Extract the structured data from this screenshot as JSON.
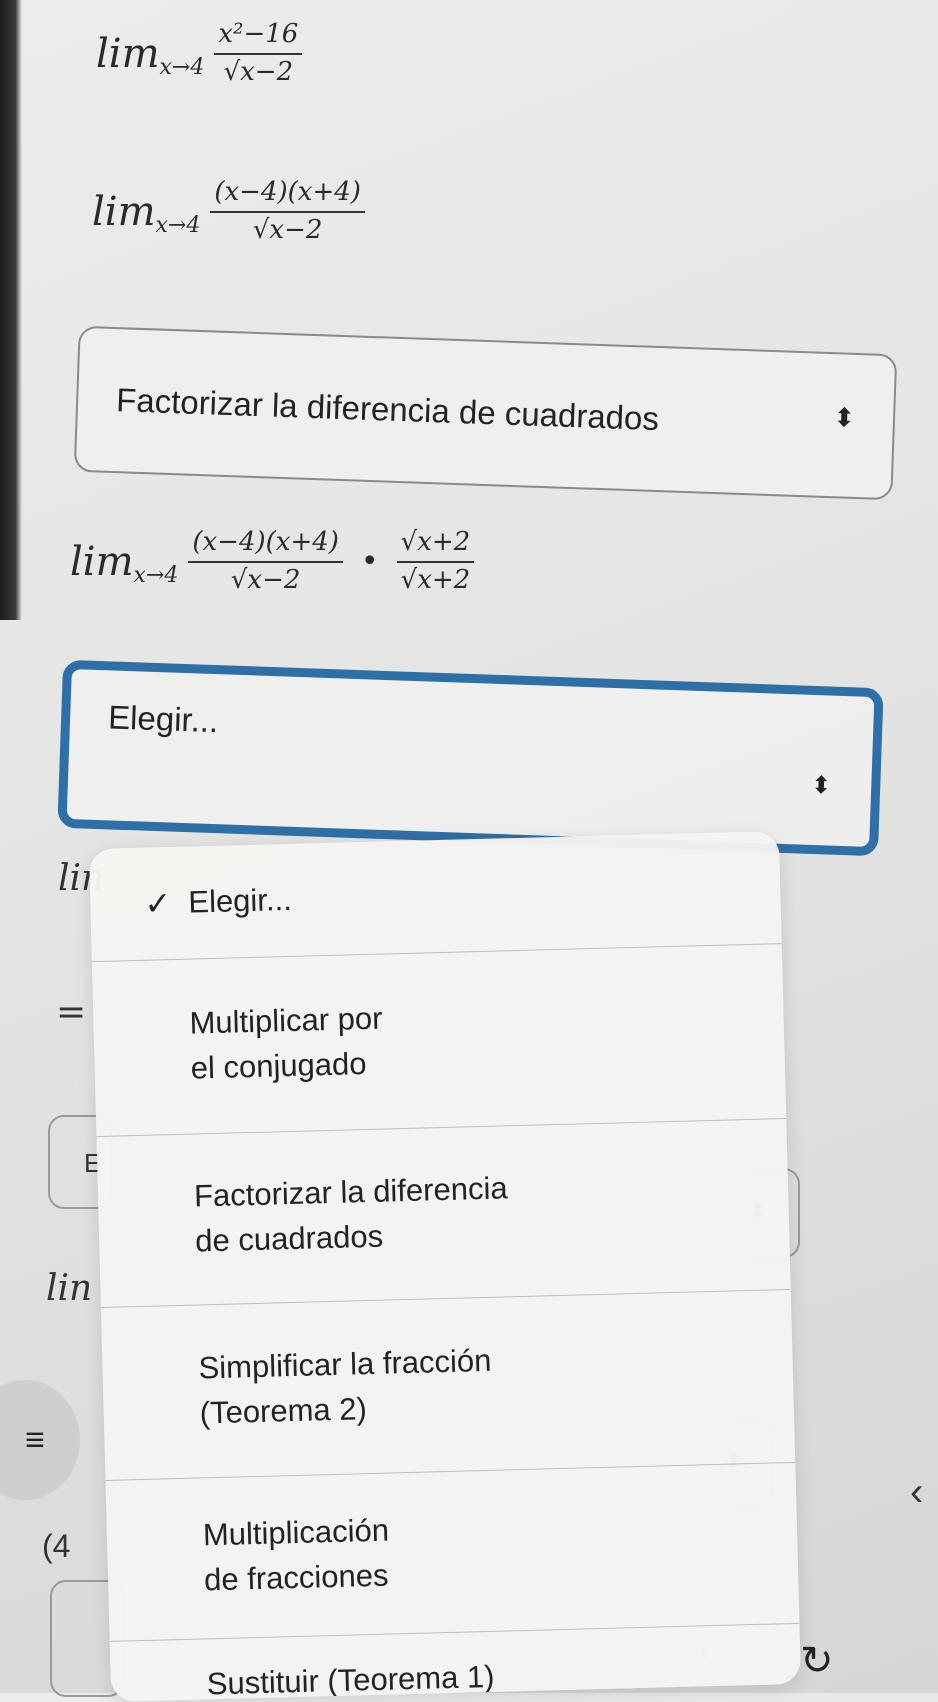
{
  "steps": {
    "step1": {
      "lim": "lim",
      "sub": "x→4",
      "num": "x²−16",
      "den": "√x−2"
    },
    "step2": {
      "lim": "lim",
      "sub": "x→4",
      "num": "(x−4)(x+4)",
      "den": "√x−2"
    },
    "select1": {
      "value": "Factorizar la diferencia de cuadrados",
      "arrow": "⬍"
    },
    "step3": {
      "lim": "lim",
      "sub": "x→4",
      "num": "(x−4)(x+4)",
      "den": "√x−2",
      "dot": "•",
      "num2": "√x+2",
      "den2": "√x+2"
    },
    "select2": {
      "value": "Elegir...",
      "arrow": "⬍"
    }
  },
  "background": {
    "lin1": "lin",
    "eq": "=",
    "e": "E",
    "lin2": "lin",
    "f": "(4",
    "list_icon": "≡",
    "small_arrow1": "⬍",
    "small_arrow2": "⬍",
    "chevron": "‹",
    "refresh_icon": "↻",
    "small_chevron": "‹"
  },
  "dropdown": {
    "options": [
      {
        "label": "Elegir...",
        "checked": true,
        "check": "✓"
      },
      {
        "label": "Multiplicar por\nel conjugado"
      },
      {
        "label": "Factorizar la diferencia\nde cuadrados"
      },
      {
        "label": "Simplificar la fracción\n(Teorema 2)"
      },
      {
        "label": "Multiplicación\nde fracciones"
      },
      {
        "label": "Sustituir (Teorema 1)"
      }
    ]
  }
}
